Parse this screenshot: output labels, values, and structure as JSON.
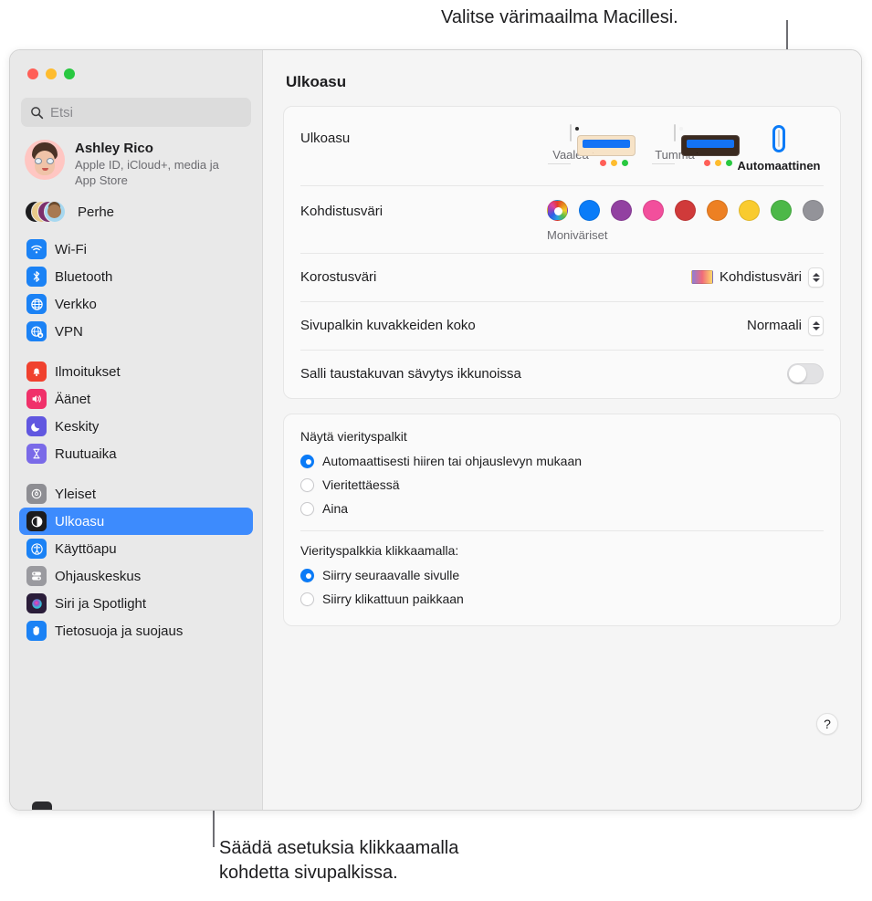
{
  "annotations": {
    "top": "Valitse värimaailma Macillesi.",
    "bottom": "Säädä asetuksia klikkaamalla\nkohdetta sivupalkissa."
  },
  "window": {
    "title": "Ulkoasu",
    "traffic_lights": [
      "close",
      "minimize",
      "zoom"
    ]
  },
  "sidebar": {
    "search": {
      "placeholder": "Etsi",
      "icon": "search-icon"
    },
    "account": {
      "name": "Ashley Rico",
      "subtitle": "Apple ID, iCloud+, media ja App Store"
    },
    "family": {
      "label": "Perhe"
    },
    "groups": [
      {
        "items": [
          {
            "label": "Wi-Fi",
            "icon": "wifi-icon",
            "color": "#1b82f5"
          },
          {
            "label": "Bluetooth",
            "icon": "bluetooth-icon",
            "color": "#1b82f5"
          },
          {
            "label": "Verkko",
            "icon": "globe-icon",
            "color": "#1b82f5"
          },
          {
            "label": "VPN",
            "icon": "vpn-globe-icon",
            "color": "#1b82f5"
          }
        ]
      },
      {
        "items": [
          {
            "label": "Ilmoitukset",
            "icon": "bell-icon",
            "color": "#f0412e"
          },
          {
            "label": "Äänet",
            "icon": "speaker-icon",
            "color": "#f0316a"
          },
          {
            "label": "Keskity",
            "icon": "moon-icon",
            "color": "#6157e0"
          },
          {
            "label": "Ruutuaika",
            "icon": "hourglass-icon",
            "color": "#7a6ae8"
          }
        ]
      },
      {
        "items": [
          {
            "label": "Yleiset",
            "icon": "gear-icon",
            "color": "#8e8e93"
          },
          {
            "label": "Ulkoasu",
            "icon": "appearance-icon",
            "color": "#1c1c1e",
            "selected": true
          },
          {
            "label": "Käyttöapu",
            "icon": "accessibility-icon",
            "color": "#1b82f5"
          },
          {
            "label": "Ohjauskeskus",
            "icon": "control-center-icon",
            "color": "#9a9a9f"
          },
          {
            "label": "Siri ja Spotlight",
            "icon": "siri-icon",
            "color": "#2b1d3a"
          },
          {
            "label": "Tietosuoja ja suojaus",
            "icon": "hand-icon",
            "color": "#1b82f5"
          }
        ]
      }
    ]
  },
  "detail": {
    "appearance": {
      "label": "Ulkoasu",
      "options": [
        {
          "label": "Vaalea",
          "selected": false
        },
        {
          "label": "Tumma",
          "selected": false
        },
        {
          "label": "Automaattinen",
          "selected": true
        }
      ]
    },
    "accent": {
      "label": "Kohdistusväri",
      "caption": "Moniväriset",
      "colors": [
        "multicolor",
        "#0a7cf8",
        "#9241a1",
        "#f24f9c",
        "#d03a3a",
        "#ed8023",
        "#f9cb2e",
        "#4cb848",
        "#939399"
      ]
    },
    "highlight": {
      "label": "Korostusväri",
      "value": "Kohdistusväri"
    },
    "sidebar_icon_size": {
      "label": "Sivupalkin kuvakkeiden koko",
      "value": "Normaali"
    },
    "wallpaper_tinting": {
      "label": "Salli taustakuvan sävytys ikkunoissa",
      "value": "off"
    },
    "scrollbars": {
      "title": "Näytä vierityspalkit",
      "options": [
        {
          "label": "Automaattisesti hiiren tai ohjauslevyn mukaan",
          "selected": true
        },
        {
          "label": "Vieritettäessä",
          "selected": false
        },
        {
          "label": "Aina",
          "selected": false
        }
      ]
    },
    "scrollbar_click": {
      "title": "Vierityspalkkia klikkaamalla:",
      "options": [
        {
          "label": "Siirry seuraavalle sivulle",
          "selected": true
        },
        {
          "label": "Siirry klikattuun paikkaan",
          "selected": false
        }
      ]
    },
    "help": {
      "label": "?"
    }
  }
}
